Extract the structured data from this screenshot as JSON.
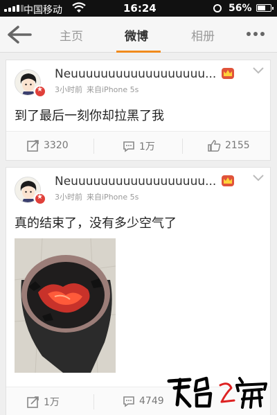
{
  "status_bar": {
    "carrier": "中国移动",
    "time": "16:24",
    "battery": "56%",
    "icons": [
      "signal-icon",
      "wifi-icon",
      "alarm-clock-icon",
      "battery-icon"
    ]
  },
  "nav": {
    "tabs": [
      {
        "label": "主页",
        "active": false
      },
      {
        "label": "微博",
        "active": true
      },
      {
        "label": "相册",
        "active": false
      }
    ],
    "accent_color": "#f08a1c"
  },
  "posts": [
    {
      "username": "Neuuuuuuuuuuuuuuuuuu...",
      "time": "3小时前",
      "source": "来自iPhone 5s",
      "text": "到了最后一刻你却拉黑了我",
      "repost_count": "3320",
      "comment_count": "1万",
      "like_count": "2155"
    },
    {
      "username": "Neuuuuuuuuuuuuuuuuuu...",
      "time": "3小时前",
      "source": "来自iPhone 5s",
      "text": "真的结束了，没有多少空气了",
      "repost_count": "1万",
      "comment_count": "4749",
      "like_count": ""
    }
  ],
  "watermark": "天台之窗"
}
